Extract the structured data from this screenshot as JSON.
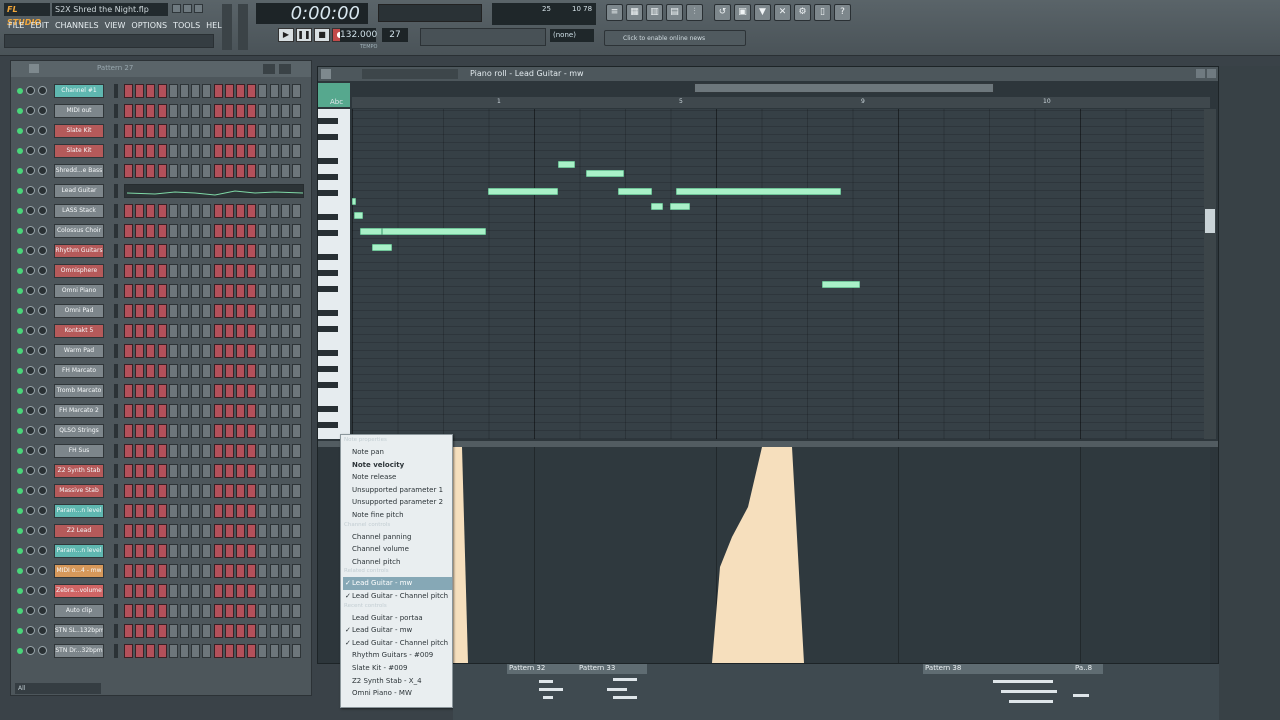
{
  "app": {
    "brand": "FL STUDIO",
    "song_title": "S2X Shred the Night.flp",
    "menu": [
      "FILE",
      "EDIT",
      "CHANNELS",
      "VIEW",
      "OPTIONS",
      "TOOLS",
      "HELP"
    ],
    "time": "0:00:00",
    "tempo": "132.000",
    "tempo_label": "TEMPO",
    "pattern_num": "27",
    "snap": "(none)",
    "online_news": "Click to enable online news",
    "cpu_value": "25",
    "poly_value": "10 78"
  },
  "rack": {
    "pattern": "Pattern 27",
    "filter": "All",
    "channels": [
      {
        "name": "Channel #1",
        "color": "teal"
      },
      {
        "name": "MIDI out",
        "color": "grey"
      },
      {
        "name": "Slate Kit",
        "color": "red"
      },
      {
        "name": "Slate Kit",
        "color": "red"
      },
      {
        "name": "Shredd...e Bass",
        "color": "grey"
      },
      {
        "name": "Lead Guitar",
        "color": "grey"
      },
      {
        "name": "LASS Stack",
        "color": "grey"
      },
      {
        "name": "Colossus Choir",
        "color": "grey"
      },
      {
        "name": "Rhythm Guitars",
        "color": "red"
      },
      {
        "name": "Omnisphere",
        "color": "red"
      },
      {
        "name": "Omni Piano",
        "color": "grey"
      },
      {
        "name": "Omni Pad",
        "color": "grey"
      },
      {
        "name": "Kontakt 5",
        "color": "red"
      },
      {
        "name": "Warm Pad",
        "color": "grey"
      },
      {
        "name": "FH Marcato",
        "color": "grey"
      },
      {
        "name": "Tromb Marcato",
        "color": "grey"
      },
      {
        "name": "FH Marcato 2",
        "color": "grey"
      },
      {
        "name": "QLSO Strings",
        "color": "grey"
      },
      {
        "name": "FH Sus",
        "color": "grey"
      },
      {
        "name": "Z2 Synth Stab",
        "color": "red"
      },
      {
        "name": "Massive Stab",
        "color": "red"
      },
      {
        "name": "Param...n level",
        "color": "teal"
      },
      {
        "name": "Z2 Lead",
        "color": "red"
      },
      {
        "name": "Param...n level",
        "color": "teal"
      },
      {
        "name": "MIDI o...4 - mw",
        "color": "orange"
      },
      {
        "name": "Zebra...volume",
        "color": "pink"
      },
      {
        "name": "Auto clip",
        "color": "grey"
      },
      {
        "name": "STN SL..132bpm",
        "color": "grey"
      },
      {
        "name": "STN Dr...32bpm",
        "color": "grey"
      }
    ]
  },
  "piano_roll": {
    "title": "Piano roll - Lead Guitar - mw",
    "ruler": [
      "1",
      "5",
      "9",
      "10"
    ],
    "key_labels": [
      "Abc"
    ]
  },
  "context_menu": {
    "sections": [
      {
        "header": "Note properties",
        "items": [
          {
            "label": "Note pan",
            "checked": false,
            "bold": false
          },
          {
            "label": "Note velocity",
            "checked": false,
            "bold": true
          },
          {
            "label": "Note release",
            "checked": false,
            "bold": false
          },
          {
            "label": "Unsupported parameter 1",
            "checked": false,
            "bold": false
          },
          {
            "label": "Unsupported parameter 2",
            "checked": false,
            "bold": false
          },
          {
            "label": "Note fine pitch",
            "checked": false,
            "bold": false
          }
        ]
      },
      {
        "header": "Channel controls",
        "items": [
          {
            "label": "Channel panning",
            "checked": false,
            "bold": false
          },
          {
            "label": "Channel volume",
            "checked": false,
            "bold": false
          },
          {
            "label": "Channel pitch",
            "checked": false,
            "bold": false
          }
        ]
      },
      {
        "header": "Related controls",
        "items": [
          {
            "label": "Lead Guitar - mw",
            "checked": true,
            "bold": false,
            "highlight": true
          },
          {
            "label": "Lead Guitar - Channel pitch",
            "checked": true,
            "bold": false
          }
        ]
      },
      {
        "header": "Recent controls",
        "items": [
          {
            "label": "Lead Guitar - portaa",
            "checked": false,
            "bold": false
          },
          {
            "label": "Lead Guitar - mw",
            "checked": true,
            "bold": false
          },
          {
            "label": "Lead Guitar - Channel pitch",
            "checked": true,
            "bold": false
          },
          {
            "label": "Rhythm Guitars - #009",
            "checked": false,
            "bold": false
          },
          {
            "label": "Slate Kit - #009",
            "checked": false,
            "bold": false
          },
          {
            "label": "Z2 Synth Stab - X_4",
            "checked": false,
            "bold": false
          },
          {
            "label": "Omni Piano - MW",
            "checked": false,
            "bold": false
          }
        ]
      }
    ]
  },
  "playlist": {
    "patterns": [
      "Pattern 32",
      "Pattern 33",
      "Pattern 38",
      "Pa..8"
    ]
  },
  "colors": {
    "note": "#a9f1c8",
    "automation": "#f6dfbd",
    "accent": "#f2a73a"
  }
}
